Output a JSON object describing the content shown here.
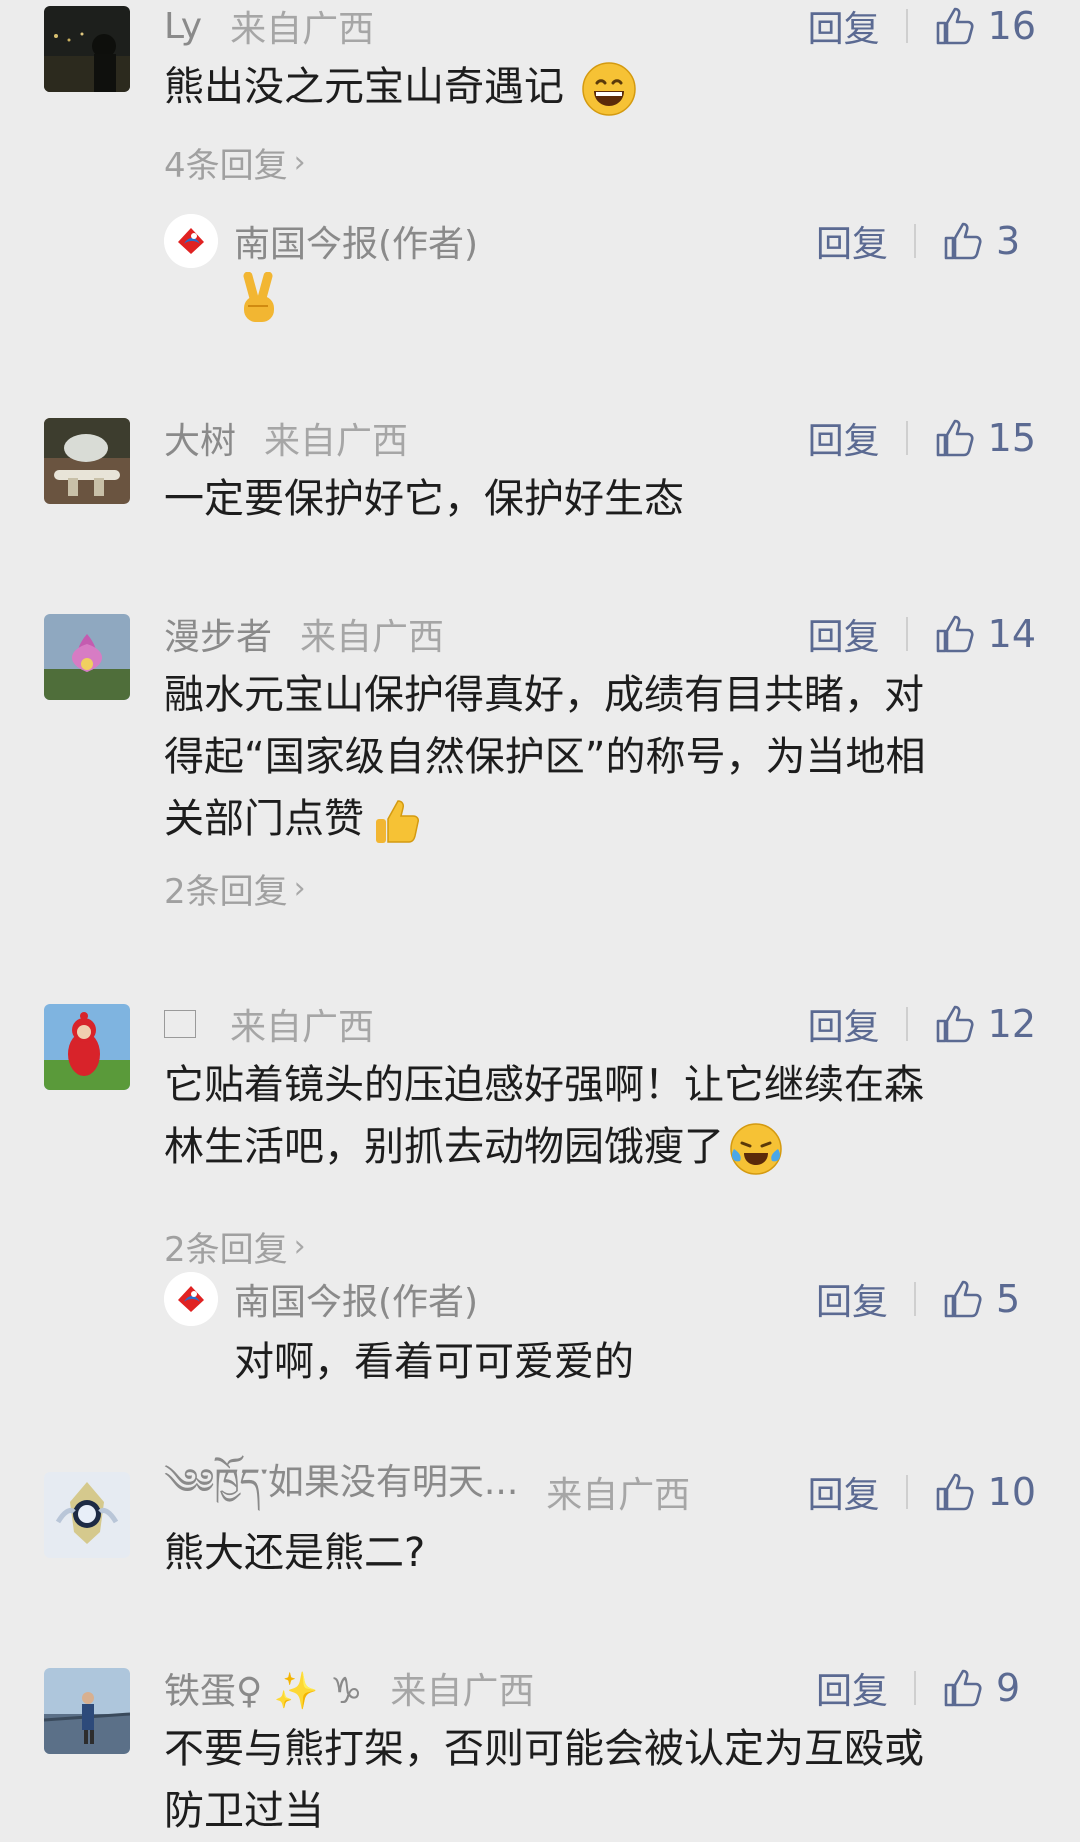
{
  "reply_label": "回复",
  "comments": [
    {
      "user": "Ly",
      "from": "来自广西",
      "likes": "16",
      "text": "熊出没之元宝山奇遇记",
      "emoji": "grinning-emoji",
      "more_replies": "4条回复",
      "reply": {
        "user": "南国今报(作者)",
        "likes": "3",
        "emoji": "victory-hand-emoji"
      }
    },
    {
      "user": "大树",
      "from": "来自广西",
      "likes": "15",
      "text": "一定要保护好它，保护好生态"
    },
    {
      "user": "漫步者",
      "from": "来自广西",
      "likes": "14",
      "lines": [
        "融水元宝山保护得真好，成绩有目共睹，对",
        "得起“国家级自然保护区”的称号，为当地相",
        "关部门点赞"
      ],
      "emoji": "thumbs-up-emoji",
      "more_replies": "2条回复"
    },
    {
      "user": "",
      "from": "来自广西",
      "likes": "12",
      "lines": [
        "它贴着镜头的压迫感好强啊！让它继续在森",
        "林生活吧，别抓去动物园饿瘦了"
      ],
      "emoji": "tears-of-joy-emoji",
      "more_replies": "2条回复",
      "reply": {
        "user": "南国今报(作者)",
        "likes": "5",
        "text": "对啊，看着可可爱爱的"
      }
    },
    {
      "user": "༄༅ཁྱོད་如果没有明天...",
      "from": "来自广西",
      "likes": "10",
      "text": "熊大还是熊二?"
    },
    {
      "user": "铁蛋♀ ✨ ♑",
      "from": "来自广西",
      "likes": "9",
      "lines": [
        "不要与熊打架，否则可能会被认定为互殴或",
        "防卫过当"
      ]
    }
  ],
  "colors": {
    "link": "#5b6a92",
    "meta": "#8a8a8a",
    "background": "#ececec"
  }
}
